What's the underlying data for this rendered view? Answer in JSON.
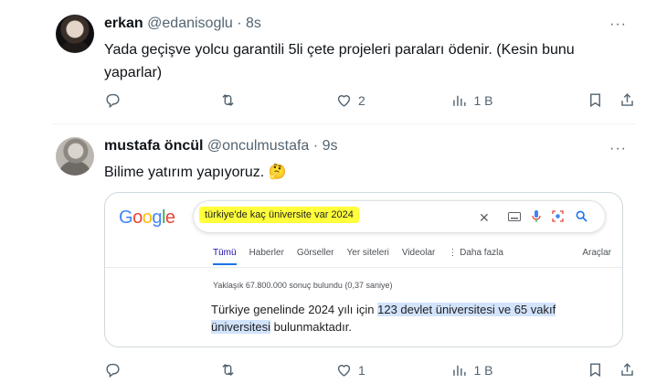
{
  "tweets": [
    {
      "username": "erkan",
      "handle": "@edanisoglu",
      "dot": "·",
      "time": "8s",
      "text": "Yada geçişve yolcu garantili 5li çete projeleri paraları ödenir. (Kesin bunu yaparlar)",
      "more": "···",
      "actions": {
        "reply_count": "",
        "retweet_count": "",
        "like_count": "2",
        "views_count": "1 B"
      }
    },
    {
      "username": "mustafa öncül",
      "handle": "@onculmustafa",
      "dot": "·",
      "time": "9s",
      "text": "Bilime yatırım yapıyoruz. 🤔",
      "more": "···",
      "actions": {
        "reply_count": "",
        "retweet_count": "",
        "like_count": "1",
        "views_count": "1 B"
      }
    }
  ],
  "google_card": {
    "logo_letters": [
      "G",
      "o",
      "o",
      "g",
      "l",
      "e"
    ],
    "logo_colors": [
      "#4285f4",
      "#ea4335",
      "#fbbc05",
      "#4285f4",
      "#34a853",
      "#ea4335"
    ],
    "query": "türkiye'de kaç üniversite var 2024",
    "clear_icon": "✕",
    "tabs": [
      "Tümü",
      "Haberler",
      "Görseller",
      "Yer siteleri",
      "Videolar",
      "⋮ Daha fazla"
    ],
    "tools": "Araçlar",
    "stats": "Yaklaşık 67.800.000 sonuç bulundu (0,37 saniye)",
    "answer_pre": "Türkiye genelinde 2024 yılı için ",
    "answer_highlight": "123 devlet üniversitesi ve 65 vakıf üniversitesi",
    "answer_post": " bulunmaktadır."
  },
  "colors": {
    "accent": "#1d9bf0",
    "muted": "#536471",
    "highlight_yellow": "#ffff3b",
    "highlight_blue": "#d2e3fc"
  }
}
